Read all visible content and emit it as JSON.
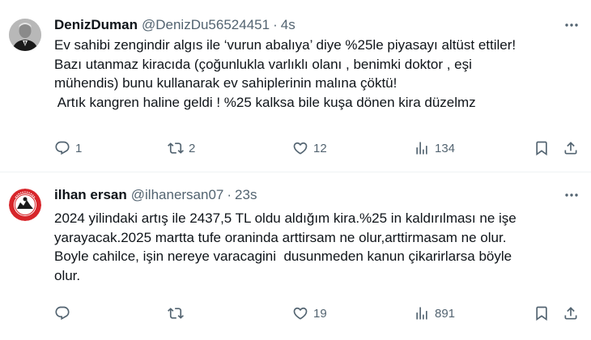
{
  "tweets": [
    {
      "name": "DenizDuman",
      "handle": "@DenizDu56524451",
      "separator": "·",
      "time": "4s",
      "lines": [
        "Ev sahibi zengindir algıs ile ‘vurun abalıya’ diye %25le piyasayı altüst ettiler!",
        "Bazı utanmaz kiracıda (çoğunlukla varlıklı olanı , benimki doktor , eşi",
        "mühendis) bunu kullanarak ev sahiplerinin malına çöktü!",
        " Artık kangren haline geldi ! %25 kalksa bile kuşa dönen kira düzelmz"
      ],
      "replies": "1",
      "retweets": "2",
      "likes": "12",
      "views": "134",
      "avatar_icon": "portrait-avatar-icon"
    },
    {
      "name": "ilhan ersan",
      "handle": "@ilhanersan07",
      "separator": "·",
      "time": "23s",
      "lines": [
        "2024 yilindaki artış ile 2437,5 TL oldu aldığım kira.%25 in kaldırılması ne işe",
        "yarayacak.2025 martta tufe oraninda arttirsam ne olur,arttirmasam ne olur.",
        "Boyle cahilce, işin nereye varacagini  dusunmeden kanun çikarirlarsa böyle",
        "olur."
      ],
      "replies": "",
      "retweets": "",
      "likes": "19",
      "views": "891",
      "avatar_icon": "red-emblem-avatar-icon"
    }
  ],
  "colors": {
    "text": "#0f1419",
    "secondary": "#536471",
    "divider": "#eff3f4",
    "avatar_red": "#d7262b"
  }
}
